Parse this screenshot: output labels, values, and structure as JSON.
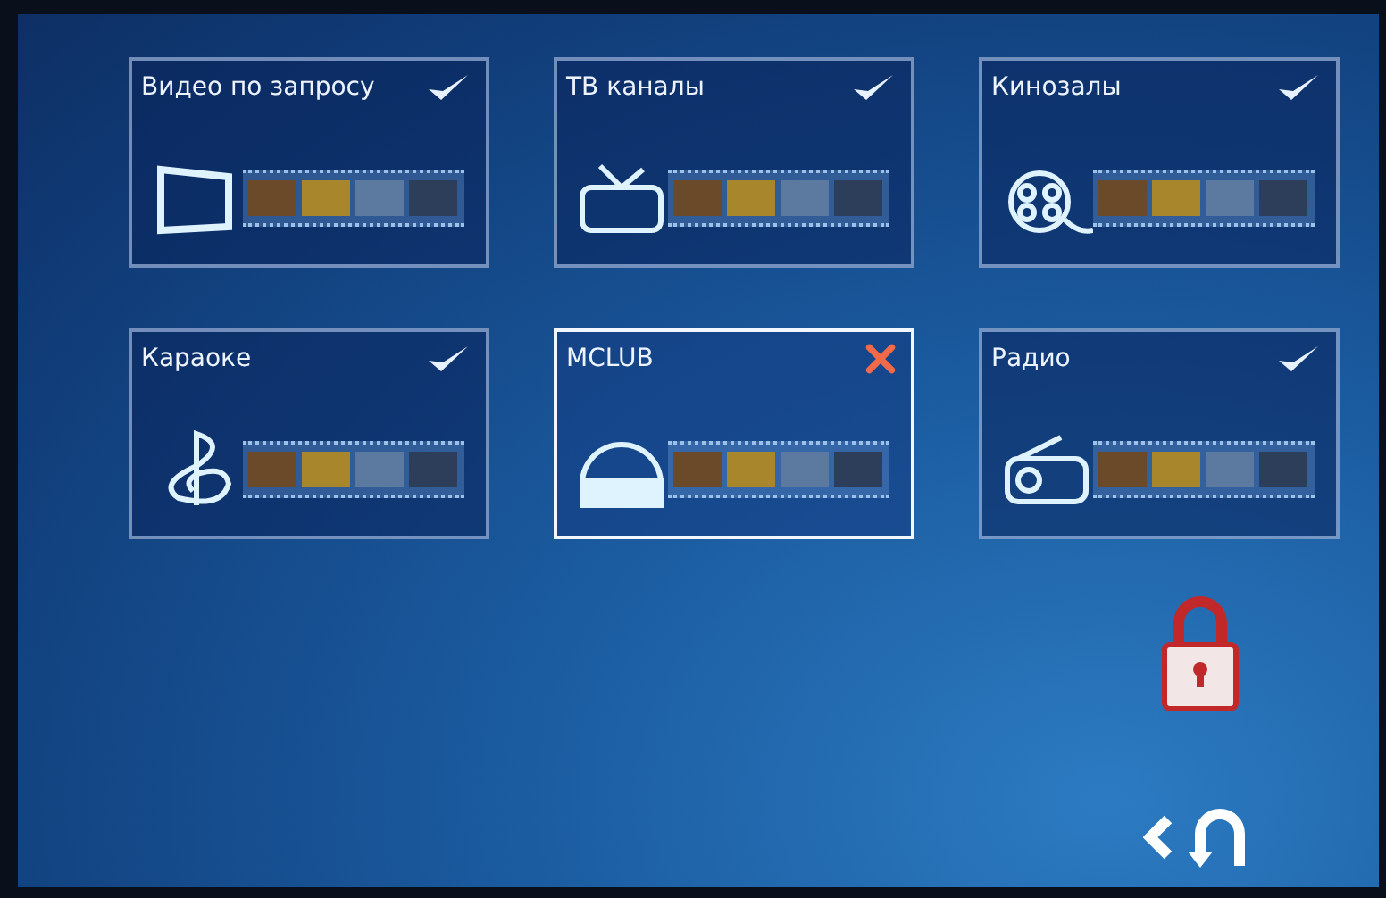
{
  "tiles": [
    {
      "label": "Видео по запросу",
      "kind": "video",
      "enabled": true,
      "selected": false
    },
    {
      "label": "ТВ каналы",
      "kind": "tv",
      "enabled": true,
      "selected": false
    },
    {
      "label": "Кинозалы",
      "kind": "cinema",
      "enabled": true,
      "selected": false
    },
    {
      "label": "Караоке",
      "kind": "karaoke",
      "enabled": true,
      "selected": false
    },
    {
      "label": "MCLUB",
      "kind": "mclub",
      "enabled": false,
      "selected": true
    },
    {
      "label": "Радио",
      "kind": "radio",
      "enabled": true,
      "selected": false
    }
  ]
}
